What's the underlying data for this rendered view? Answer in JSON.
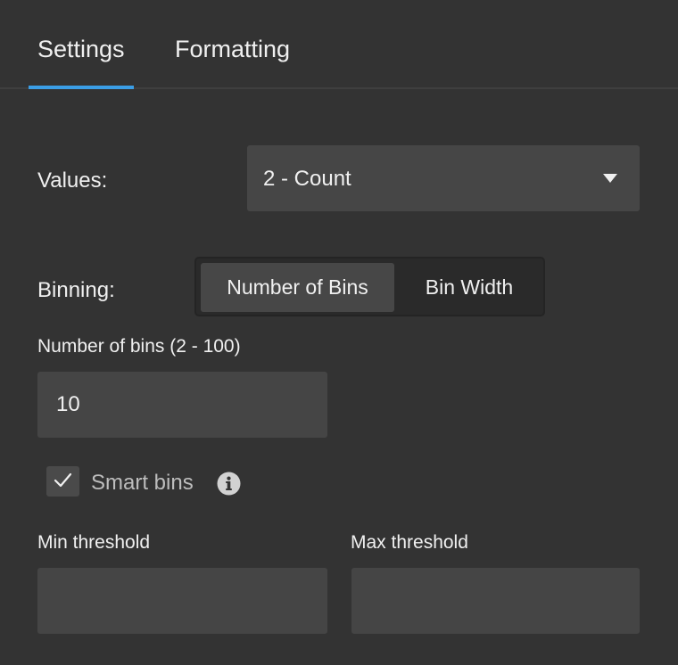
{
  "tabs": [
    {
      "label": "Settings",
      "active": true
    },
    {
      "label": "Formatting",
      "active": false
    }
  ],
  "accent_color": "#3b9ee6",
  "values": {
    "label": "Values:",
    "selected": "2 - Count"
  },
  "binning": {
    "label": "Binning:",
    "options": [
      "Number of Bins",
      "Bin Width"
    ],
    "selected": "Number of Bins"
  },
  "num_bins": {
    "label": "Number of bins (2 - 100)",
    "value": "10"
  },
  "smart_bins": {
    "label": "Smart bins",
    "checked": true,
    "icon": "info-icon"
  },
  "min_threshold": {
    "label": "Min threshold",
    "value": ""
  },
  "max_threshold": {
    "label": "Max threshold",
    "value": ""
  }
}
